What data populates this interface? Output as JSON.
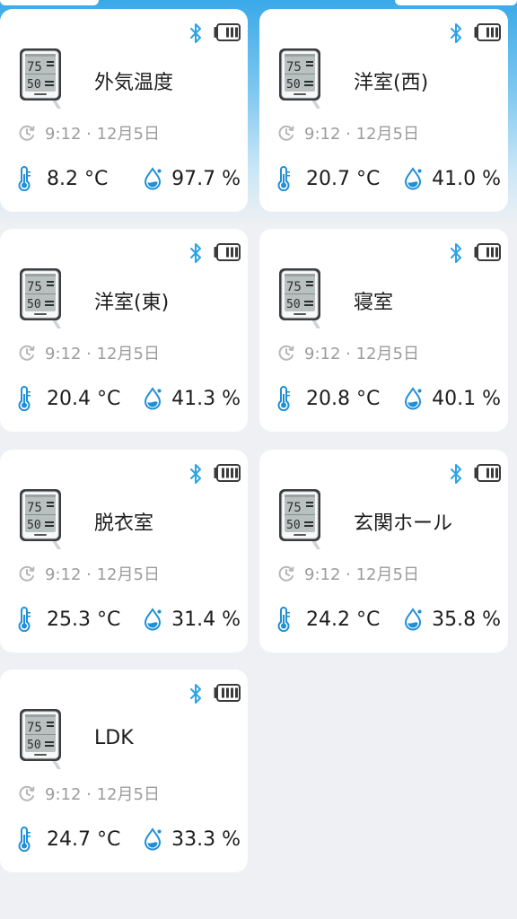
{
  "colors": {
    "accent": "#1f8fd8",
    "bluetooth": "#2aa3e6",
    "muted_text": "#9c9c9c",
    "card": "#ffffff",
    "background": "#eef0f3"
  },
  "icons": {
    "bluetooth": "bluetooth-icon",
    "battery": "battery-icon",
    "clock": "clock-icon",
    "temperature": "thermometer-icon",
    "humidity": "humidity-drop-icon",
    "device": "thermo-hygrometer-device-icon"
  },
  "sensors": [
    {
      "name": "外気温度",
      "time": "9:12 · 12月5日",
      "temperature": "8.2 °C",
      "humidity": "97.7 %",
      "battery_level": 0.75
    },
    {
      "name": "洋室(西)",
      "time": "9:12 · 12月5日",
      "temperature": "20.7 °C",
      "humidity": "41.0 %",
      "battery_level": 0.75
    },
    {
      "name": "洋室(東)",
      "time": "9:12 · 12月5日",
      "temperature": "20.4 °C",
      "humidity": "41.3 %",
      "battery_level": 0.75
    },
    {
      "name": "寝室",
      "time": "9:12 · 12月5日",
      "temperature": "20.8 °C",
      "humidity": "40.1 %",
      "battery_level": 0.75
    },
    {
      "name": "脱衣室",
      "time": "9:12 · 12月5日",
      "temperature": "25.3 °C",
      "humidity": "31.4 %",
      "battery_level": 1.0
    },
    {
      "name": "玄関ホール",
      "time": "9:12 · 12月5日",
      "temperature": "24.2 °C",
      "humidity": "35.8 %",
      "battery_level": 0.75
    },
    {
      "name": "LDK",
      "time": "9:12 · 12月5日",
      "temperature": "24.7 °C",
      "humidity": "33.3 %",
      "battery_level": 1.0
    }
  ]
}
